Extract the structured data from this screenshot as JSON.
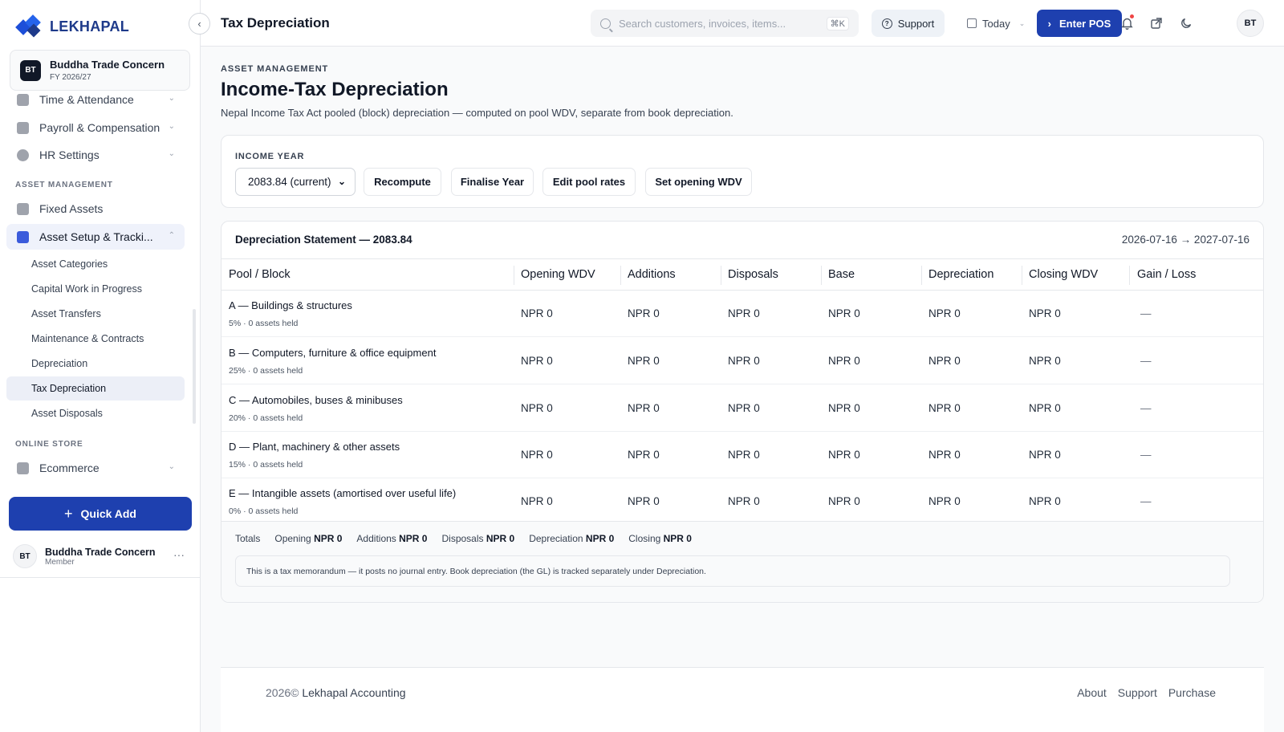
{
  "brand": {
    "name": "LEKHAPAL"
  },
  "org": {
    "initials": "BT",
    "name": "Buddha Trade Concern",
    "fiscal_year": "FY 2026/27"
  },
  "sidebar": {
    "items": [
      {
        "label": "Time & Attendance"
      },
      {
        "label": "Payroll & Compensation"
      },
      {
        "label": "HR Settings"
      }
    ],
    "sections": {
      "asset_management": "ASSET MANAGEMENT",
      "online_store": "ONLINE STORE"
    },
    "asset_items": [
      {
        "label": "Fixed Assets"
      },
      {
        "label": "Asset Setup & Tracki..."
      }
    ],
    "sub_items": [
      {
        "label": "Asset Categories"
      },
      {
        "label": "Capital Work in Progress"
      },
      {
        "label": "Asset Transfers"
      },
      {
        "label": "Maintenance & Contracts"
      },
      {
        "label": "Depreciation"
      },
      {
        "label": "Tax Depreciation"
      },
      {
        "label": "Asset Disposals"
      }
    ],
    "store_items": [
      {
        "label": "Ecommerce"
      }
    ],
    "quick_add": "Quick Add",
    "user": {
      "initials": "BT",
      "name": "Buddha Trade Concern",
      "role": "Member"
    }
  },
  "topbar": {
    "title": "Tax Depreciation",
    "search_placeholder": "Search customers, invoices, items...",
    "search_shortcut": "⌘K",
    "support_label": "Support",
    "today_label": "Today",
    "pos_label": "Enter POS",
    "avatar_initials": "BT"
  },
  "page": {
    "eyebrow": "ASSET MANAGEMENT",
    "title": "Income-Tax Depreciation",
    "subtitle": "Nepal Income Tax Act pooled (block) depreciation — computed on pool WDV, separate from book depreciation."
  },
  "year_card": {
    "label": "INCOME YEAR",
    "selected_year": "2083.84 (current)",
    "buttons": {
      "recompute": "Recompute",
      "finalise": "Finalise Year",
      "edit_rates": "Edit pool rates",
      "opening_wdv": "Set opening WDV"
    }
  },
  "statement": {
    "title": "Depreciation Statement — 2083.84",
    "range": "2026-07-16 → 2027-07-16",
    "columns": [
      "Pool / Block",
      "Opening WDV",
      "Additions",
      "Disposals",
      "Base",
      "Depreciation",
      "Closing WDV",
      "Gain / Loss"
    ],
    "rows": [
      {
        "name": "A — Buildings & structures",
        "meta": "5% · 0 assets held",
        "opening": "NPR 0",
        "additions": "NPR 0",
        "disposals": "NPR 0",
        "base": "NPR 0",
        "depreciation": "NPR 0",
        "closing": "NPR 0",
        "gain_loss": "—"
      },
      {
        "name": "B — Computers, furniture & office equipment",
        "meta": "25% · 0 assets held",
        "opening": "NPR 0",
        "additions": "NPR 0",
        "disposals": "NPR 0",
        "base": "NPR 0",
        "depreciation": "NPR 0",
        "closing": "NPR 0",
        "gain_loss": "—"
      },
      {
        "name": "C — Automobiles, buses & minibuses",
        "meta": "20% · 0 assets held",
        "opening": "NPR 0",
        "additions": "NPR 0",
        "disposals": "NPR 0",
        "base": "NPR 0",
        "depreciation": "NPR 0",
        "closing": "NPR 0",
        "gain_loss": "—"
      },
      {
        "name": "D — Plant, machinery & other assets",
        "meta": "15% · 0 assets held",
        "opening": "NPR 0",
        "additions": "NPR 0",
        "disposals": "NPR 0",
        "base": "NPR 0",
        "depreciation": "NPR 0",
        "closing": "NPR 0",
        "gain_loss": "—"
      },
      {
        "name": "E — Intangible assets (amortised over useful life)",
        "meta": "0% · 0 assets held",
        "opening": "NPR 0",
        "additions": "NPR 0",
        "disposals": "NPR 0",
        "base": "NPR 0",
        "depreciation": "NPR 0",
        "closing": "NPR 0",
        "gain_loss": "—"
      }
    ],
    "totals": {
      "label": "Totals",
      "opening_label": "Opening",
      "opening": "NPR 0",
      "additions_label": "Additions",
      "additions": "NPR 0",
      "disposals_label": "Disposals",
      "disposals": "NPR 0",
      "depreciation_label": "Depreciation",
      "depreciation": "NPR 0",
      "closing_label": "Closing",
      "closing": "NPR 0"
    },
    "memo": "This is a tax memorandum — it posts no journal entry. Book depreciation (the GL) is tracked separately under Depreciation."
  },
  "footer": {
    "year": "2026©",
    "company": "Lekhapal Accounting",
    "links": [
      "About",
      "Support",
      "Purchase"
    ]
  },
  "colors": {
    "accent": "#1e40af",
    "active_bg": "#eff2fb"
  }
}
